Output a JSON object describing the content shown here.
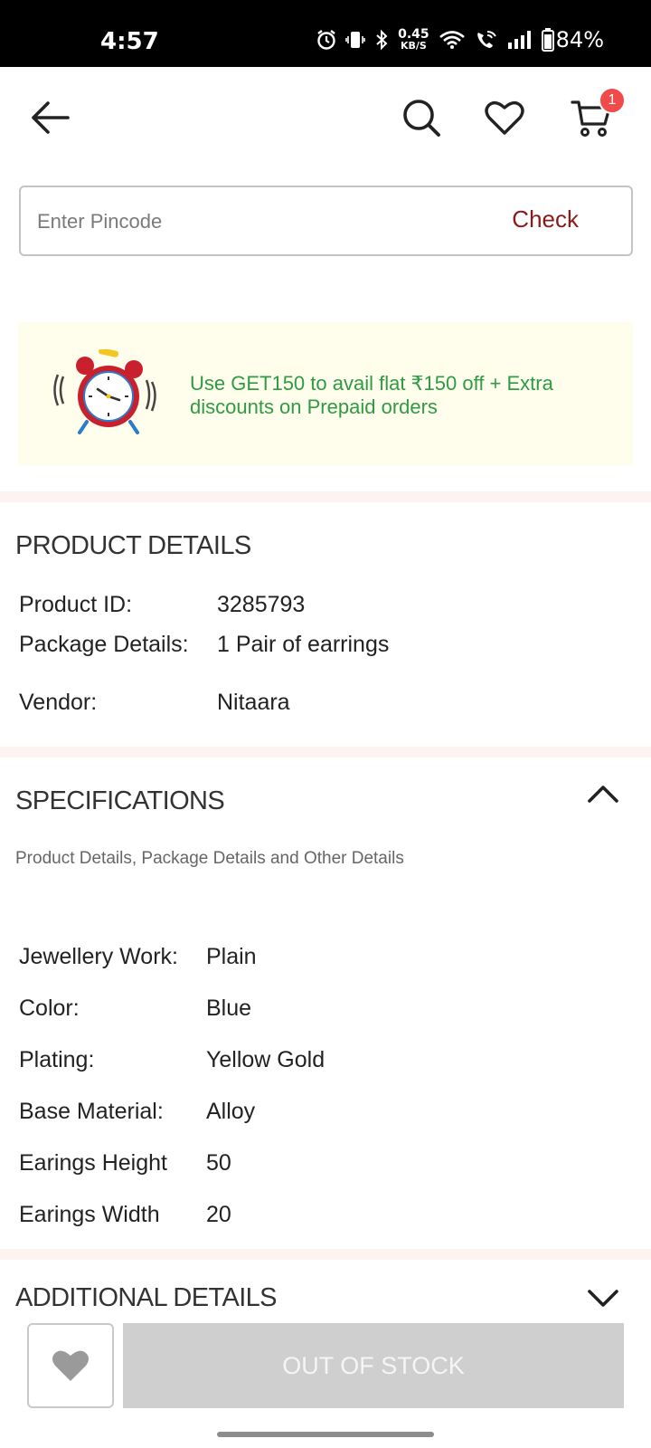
{
  "status_bar": {
    "time": "4:57",
    "net_speed_value": "0.45",
    "net_speed_unit": "KB/S",
    "battery": "84%",
    "icons": [
      "alarm-icon",
      "vibrate-icon",
      "bluetooth-icon",
      "wifi-icon",
      "wifi-call-icon",
      "signal-icon",
      "battery-icon"
    ]
  },
  "header": {
    "icons": [
      "back-arrow-icon",
      "search-icon",
      "heart-icon",
      "cart-icon"
    ],
    "cart_count": "1"
  },
  "pincode": {
    "placeholder": "Enter Pincode",
    "value": "",
    "check_label": "Check"
  },
  "promo": {
    "icon": "alarm-clock-icon",
    "text": "Use GET150 to avail flat ₹150 off + Extra discounts on Prepaid orders"
  },
  "product_details": {
    "title": "PRODUCT DETAILS",
    "rows": [
      {
        "label": "Product ID:",
        "value": "3285793"
      },
      {
        "label": "Package Details:",
        "value": "1 Pair of earrings"
      },
      {
        "label": "Vendor:",
        "value": "Nitaara"
      }
    ]
  },
  "specifications": {
    "title": "SPECIFICATIONS",
    "subtitle": "Product Details, Package Details and Other Details",
    "expanded": true,
    "rows": [
      {
        "label": "Jewellery Work:",
        "value": "Plain"
      },
      {
        "label": "Color:",
        "value": "Blue"
      },
      {
        "label": "Plating:",
        "value": "Yellow Gold"
      },
      {
        "label": "Base Material:",
        "value": "Alloy"
      },
      {
        "label": "Earings Height",
        "value": "50"
      },
      {
        "label": "Earings Width",
        "value": "20"
      }
    ]
  },
  "additional_details": {
    "title": "ADDITIONAL DETAILS",
    "expanded": false
  },
  "bottom_bar": {
    "wishlist_icon": "heart-filled-icon",
    "button_label": "OUT OF STOCK"
  },
  "colors": {
    "check": "#8b1a1a",
    "promo_text": "#2e9b45",
    "promo_bg": "#fffdeb",
    "badge": "#ef4b4b",
    "disabled_button": "#cfcfcf"
  }
}
